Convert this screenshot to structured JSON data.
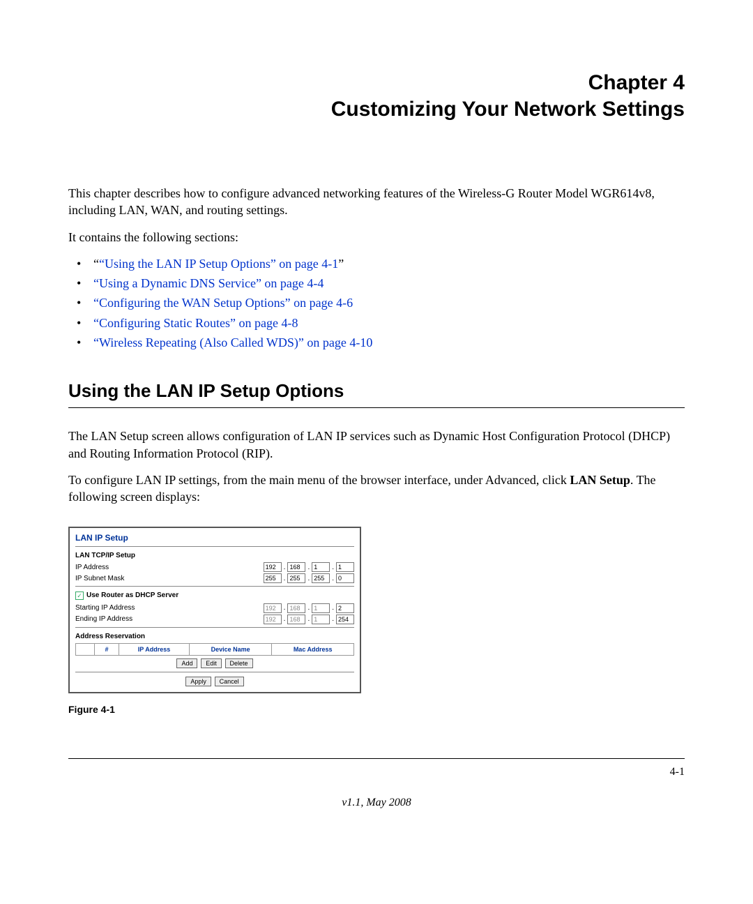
{
  "chapter": {
    "line1": "Chapter 4",
    "line2": "Customizing Your Network Settings"
  },
  "intro": "This chapter describes how to configure advanced networking features of the Wireless-G Router Model WGR614v8, including LAN, WAN, and routing settings.",
  "intro2": "It contains the following sections:",
  "toc": [
    {
      "prefix": "“",
      "link": "“Using the LAN IP Setup Options” on page 4-1",
      "suffix": "”"
    },
    {
      "link": "“Using a Dynamic DNS Service” on page 4-4"
    },
    {
      "link": "“Configuring the WAN Setup Options” on page 4-6"
    },
    {
      "link": "“Configuring Static Routes” on page 4-8"
    },
    {
      "link": "“Wireless Repeating (Also Called WDS)” on page 4-10"
    }
  ],
  "section_heading": "Using the LAN IP Setup Options",
  "para1": "The LAN Setup screen allows configuration of LAN IP services such as Dynamic Host Configuration Protocol (DHCP) and Routing Information Protocol (RIP).",
  "para2a": "To configure LAN IP settings, from the main menu of the browser interface, under Advanced, click ",
  "para2b": "LAN Setup",
  "para2c": ". The following screen displays:",
  "screenshot": {
    "title": "LAN IP Setup",
    "tcp_heading": "LAN TCP/IP Setup",
    "ip_label": "IP Address",
    "subnet_label": "IP Subnet Mask",
    "ip": [
      "192",
      "168",
      "1",
      "1"
    ],
    "subnet": [
      "255",
      "255",
      "255",
      "0"
    ],
    "dhcp_check_label": "Use Router as DHCP Server",
    "start_label": "Starting IP Address",
    "end_label": "Ending IP Address",
    "start_ip": [
      "192",
      "168",
      "1",
      "2"
    ],
    "end_ip": [
      "192",
      "168",
      "1",
      "254"
    ],
    "res_heading": "Address Reservation",
    "cols": {
      "num": "#",
      "ip": "IP Address",
      "dev": "Device Name",
      "mac": "Mac Address"
    },
    "btn_add": "Add",
    "btn_edit": "Edit",
    "btn_delete": "Delete",
    "btn_apply": "Apply",
    "btn_cancel": "Cancel"
  },
  "figure_caption": "Figure 4-1",
  "footer_page": "4-1",
  "footer_version": "v1.1, May 2008"
}
